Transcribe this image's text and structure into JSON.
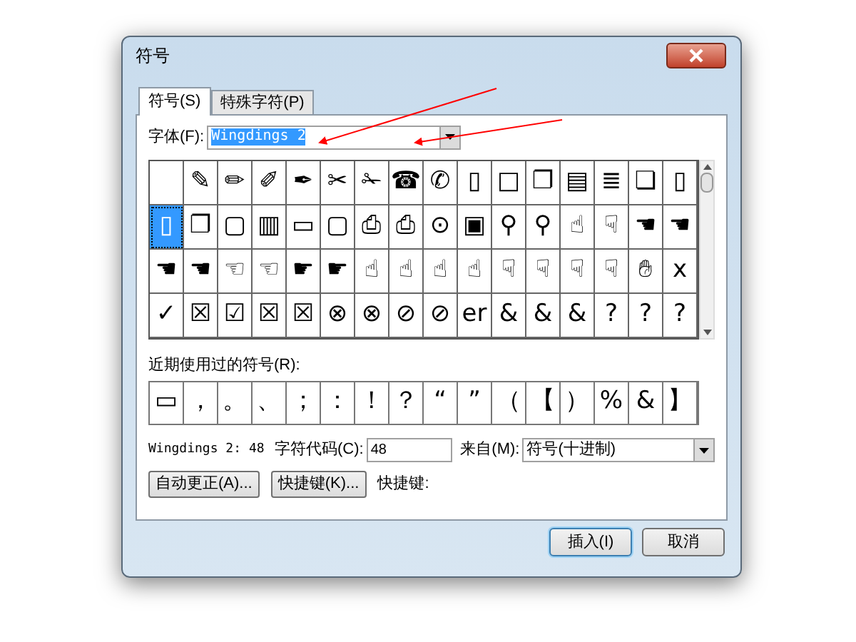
{
  "window": {
    "title": "符号"
  },
  "tabs": [
    {
      "label": "符号(S)",
      "selected": true
    },
    {
      "label": "特殊字符(P)",
      "selected": false
    }
  ],
  "font_field": {
    "label": "字体(F):",
    "value": "Wingdings 2"
  },
  "symbol_grid": {
    "rows": [
      [
        {
          "selected": false
        },
        {
          "symbol": "✎",
          "selected": false
        },
        {
          "symbol": "✏",
          "selected": false
        },
        {
          "symbol": "✐",
          "selected": false
        },
        {
          "symbol": "✒",
          "selected": false
        },
        {
          "symbol": "✂",
          "selected": false
        },
        {
          "symbol": "✁",
          "selected": false
        },
        {
          "symbol": "☎",
          "selected": false
        },
        {
          "symbol": "✆",
          "selected": false
        },
        {
          "symbol": "▯",
          "selected": false
        },
        {
          "symbol": "□",
          "selected": false
        },
        {
          "symbol": "❐",
          "selected": false
        },
        {
          "symbol": "▤",
          "selected": false
        },
        {
          "symbol": "≣",
          "selected": false
        },
        {
          "symbol": "❏",
          "selected": false
        },
        {
          "symbol": "▯",
          "selected": false
        }
      ],
      [
        {
          "symbol": "▯",
          "selected": true
        },
        {
          "symbol": "❐",
          "selected": false
        },
        {
          "symbol": "▢",
          "selected": false
        },
        {
          "symbol": "▥",
          "selected": false
        },
        {
          "symbol": "▭",
          "selected": false
        },
        {
          "symbol": "▢",
          "selected": false
        },
        {
          "symbol": "⎙",
          "selected": false
        },
        {
          "symbol": "⎙",
          "selected": false
        },
        {
          "symbol": "⊙",
          "selected": false
        },
        {
          "symbol": "▣",
          "selected": false
        },
        {
          "symbol": "⚲",
          "selected": false
        },
        {
          "symbol": "⚲",
          "selected": false
        },
        {
          "symbol": "☝",
          "selected": false
        },
        {
          "symbol": "☟",
          "selected": false
        },
        {
          "symbol": "☚",
          "selected": false
        },
        {
          "symbol": "☚",
          "selected": false
        }
      ],
      [
        {
          "symbol": "☚",
          "selected": false
        },
        {
          "symbol": "☚",
          "selected": false
        },
        {
          "symbol": "☜",
          "selected": false
        },
        {
          "symbol": "☜",
          "selected": false
        },
        {
          "symbol": "☛",
          "selected": false
        },
        {
          "symbol": "☛",
          "selected": false
        },
        {
          "symbol": "☝",
          "selected": false
        },
        {
          "symbol": "☝",
          "selected": false
        },
        {
          "symbol": "☝",
          "selected": false
        },
        {
          "symbol": "☝",
          "selected": false
        },
        {
          "symbol": "☟",
          "selected": false
        },
        {
          "symbol": "☟",
          "selected": false
        },
        {
          "symbol": "☟",
          "selected": false
        },
        {
          "symbol": "☟",
          "selected": false
        },
        {
          "symbol": "✋︎",
          "selected": false
        },
        {
          "symbol": "x",
          "selected": false
        }
      ],
      [
        {
          "symbol": "✓",
          "selected": false
        },
        {
          "symbol": "☒",
          "selected": false
        },
        {
          "symbol": "☑",
          "selected": false
        },
        {
          "symbol": "☒",
          "selected": false
        },
        {
          "symbol": "☒",
          "selected": false
        },
        {
          "symbol": "⊗",
          "selected": false
        },
        {
          "symbol": "⊗",
          "selected": false
        },
        {
          "symbol": "⊘",
          "selected": false
        },
        {
          "symbol": "⊘",
          "selected": false
        },
        {
          "symbol": "er",
          "selected": false
        },
        {
          "symbol": "&",
          "selected": false
        },
        {
          "symbol": "&",
          "selected": false
        },
        {
          "symbol": "&",
          "selected": false
        },
        {
          "symbol": "?",
          "selected": false
        },
        {
          "symbol": "?",
          "selected": false
        },
        {
          "symbol": "?",
          "selected": false
        }
      ]
    ]
  },
  "recent": {
    "label": "近期使用过的符号(R):",
    "symbols": [
      "▭",
      "，",
      "。",
      "、",
      "；",
      "：",
      "！",
      "？",
      "“",
      "”",
      "（",
      "【",
      "）",
      "%",
      "&",
      "】"
    ]
  },
  "info": "Wingdings 2: 48",
  "char_code": {
    "label": "字符代码(C):",
    "value": "48"
  },
  "from": {
    "label": "来自(M):",
    "value": "符号(十进制)"
  },
  "buttons": [
    "自动更正(A)...",
    "快捷键(K)..."
  ],
  "shortcut_label": "快捷键:",
  "footer_buttons": [
    {
      "label": "插入(I)",
      "default": true
    },
    {
      "label": "取消",
      "default": false
    }
  ]
}
